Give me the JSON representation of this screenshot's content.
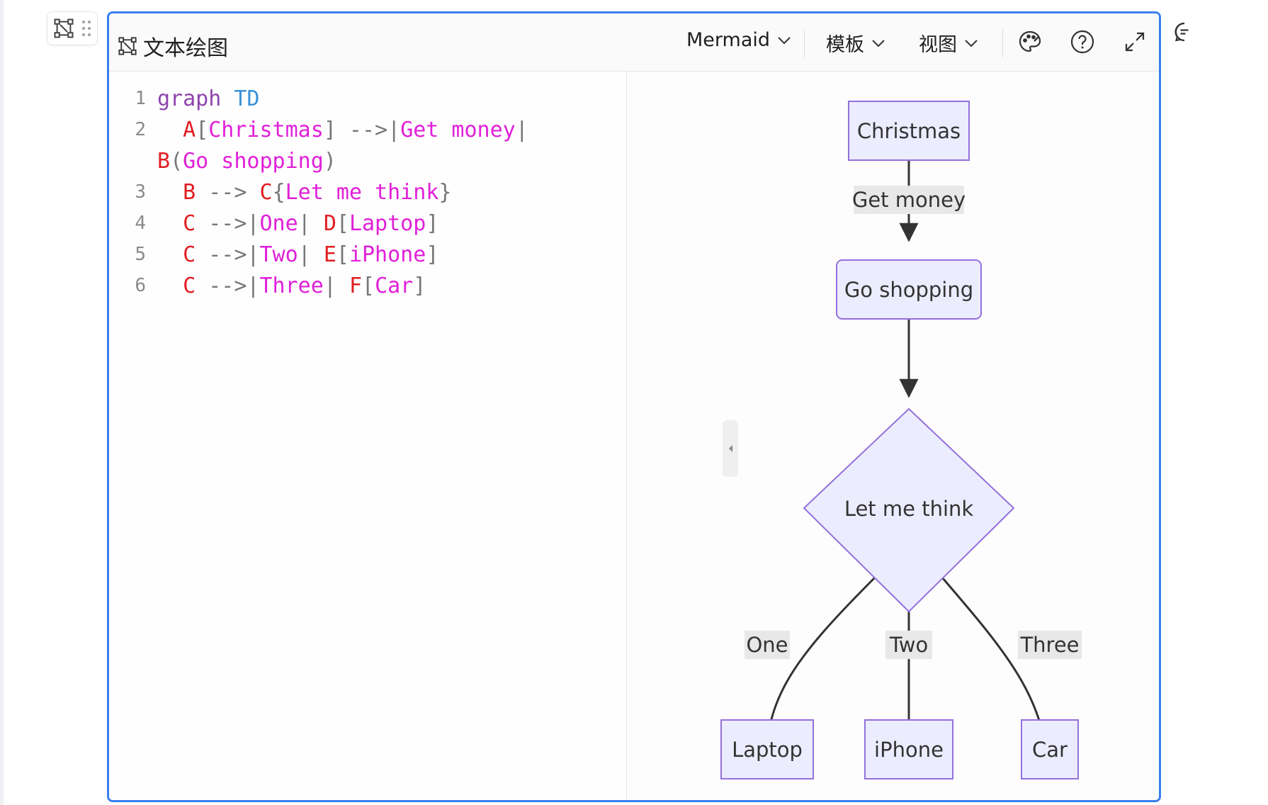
{
  "toolbar": {
    "title": "文本绘图",
    "menus": [
      {
        "label": "Mermaid"
      },
      {
        "label": "模板"
      },
      {
        "label": "视图"
      }
    ]
  },
  "editor": {
    "lines": [
      {
        "num": "1",
        "tokens": [
          {
            "t": "graph ",
            "c": "kw"
          },
          {
            "t": "TD",
            "c": "kw2"
          }
        ]
      },
      {
        "num": "2",
        "tokens": [
          {
            "t": "  A",
            "c": "id"
          },
          {
            "t": "[",
            "c": "op"
          },
          {
            "t": "Christmas",
            "c": "str"
          },
          {
            "t": "] -->|",
            "c": "op"
          },
          {
            "t": "Get money",
            "c": "str"
          },
          {
            "t": "|",
            "c": "op"
          }
        ]
      },
      {
        "num": "",
        "tokens": [
          {
            "t": "B",
            "c": "id"
          },
          {
            "t": "(",
            "c": "op"
          },
          {
            "t": "Go shopping",
            "c": "str"
          },
          {
            "t": ")",
            "c": "op"
          }
        ]
      },
      {
        "num": "3",
        "tokens": [
          {
            "t": "  B",
            "c": "id"
          },
          {
            "t": " --> ",
            "c": "op"
          },
          {
            "t": "C",
            "c": "id"
          },
          {
            "t": "{",
            "c": "op"
          },
          {
            "t": "Let me think",
            "c": "str"
          },
          {
            "t": "}",
            "c": "op"
          }
        ]
      },
      {
        "num": "4",
        "tokens": [
          {
            "t": "  C",
            "c": "id"
          },
          {
            "t": " -->|",
            "c": "op"
          },
          {
            "t": "One",
            "c": "str"
          },
          {
            "t": "| ",
            "c": "op"
          },
          {
            "t": "D",
            "c": "id"
          },
          {
            "t": "[",
            "c": "op"
          },
          {
            "t": "Laptop",
            "c": "str"
          },
          {
            "t": "]",
            "c": "op"
          }
        ]
      },
      {
        "num": "5",
        "tokens": [
          {
            "t": "  C",
            "c": "id"
          },
          {
            "t": " -->|",
            "c": "op"
          },
          {
            "t": "Two",
            "c": "str"
          },
          {
            "t": "| ",
            "c": "op"
          },
          {
            "t": "E",
            "c": "id"
          },
          {
            "t": "[",
            "c": "op"
          },
          {
            "t": "iPhone",
            "c": "str"
          },
          {
            "t": "]",
            "c": "op"
          }
        ]
      },
      {
        "num": "6",
        "tokens": [
          {
            "t": "  C",
            "c": "id"
          },
          {
            "t": " -->|",
            "c": "op"
          },
          {
            "t": "Three",
            "c": "str"
          },
          {
            "t": "| ",
            "c": "op"
          },
          {
            "t": "F",
            "c": "id"
          },
          {
            "t": "[",
            "c": "op"
          },
          {
            "t": "Car",
            "c": "str"
          },
          {
            "t": "]",
            "c": "op"
          }
        ]
      }
    ]
  },
  "diagram": {
    "nodes": {
      "christmas": "Christmas",
      "go_shopping": "Go shopping",
      "let_me_think": "Let me think",
      "laptop": "Laptop",
      "iphone": "iPhone",
      "car": "Car"
    },
    "edge_labels": {
      "get_money": "Get money",
      "one": "One",
      "two": "Two",
      "three": "Three"
    }
  },
  "colors": {
    "accent": "#3a7ff0",
    "node_fill": "#ececff",
    "node_stroke": "#9370db",
    "edge": "#333333",
    "edge_label_bg": "#e8e8e8"
  }
}
